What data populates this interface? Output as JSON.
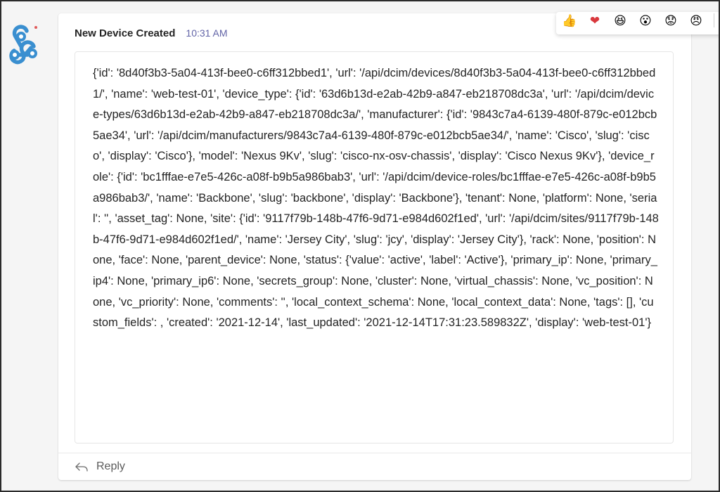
{
  "message": {
    "sender": "New Device Created",
    "time": "10:31 AM",
    "body": "{'id': '8d40f3b3-5a04-413f-bee0-c6ff312bbed1', 'url': '/api/dcim/devices/8d40f3b3-5a04-413f-bee0-c6ff312bbed1/', 'name': 'web-test-01', 'device_type': {'id': '63d6b13d-e2ab-42b9-a847-eb218708dc3a', 'url': '/api/dcim/device-types/63d6b13d-e2ab-42b9-a847-eb218708dc3a/', 'manufacturer': {'id': '9843c7a4-6139-480f-879c-e012bcb5ae34', 'url': '/api/dcim/manufacturers/9843c7a4-6139-480f-879c-e012bcb5ae34/', 'name': 'Cisco', 'slug': 'cisco', 'display': 'Cisco'}, 'model': 'Nexus 9Kv', 'slug': 'cisco-nx-osv-chassis', 'display': 'Cisco Nexus 9Kv'}, 'device_role': {'id': 'bc1fffae-e7e5-426c-a08f-b9b5a986bab3', 'url': '/api/dcim/device-roles/bc1fffae-e7e5-426c-a08f-b9b5a986bab3/', 'name': 'Backbone', 'slug': 'backbone', 'display': 'Backbone'}, 'tenant': None, 'platform': None, 'serial': '', 'asset_tag': None, 'site': {'id': '9117f79b-148b-47f6-9d71-e984d602f1ed', 'url': '/api/dcim/sites/9117f79b-148b-47f6-9d71-e984d602f1ed/', 'name': 'Jersey City', 'slug': 'jcy', 'display': 'Jersey City'}, 'rack': None, 'position': None, 'face': None, 'parent_device': None, 'status': {'value': 'active', 'label': 'Active'}, 'primary_ip': None, 'primary_ip4': None, 'primary_ip6': None, 'secrets_group': None, 'cluster': None, 'virtual_chassis': None, 'vc_position': None, 'vc_priority': None, 'comments': '', 'local_context_schema': None, 'local_context_data': None, 'tags': [], 'custom_fields': , 'created': '2021-12-14', 'last_updated': '2021-12-14T17:31:23.589832Z', 'display': 'web-test-01'}"
  },
  "reply": {
    "label": "Reply",
    "icon": "reply-arrow-icon"
  },
  "avatar": {
    "icon": "webhook-icon",
    "color": "#3a8fd0"
  },
  "reactions": [
    {
      "icon": "like-icon",
      "glyph": "👍"
    },
    {
      "icon": "heart-icon",
      "glyph": "❤"
    },
    {
      "icon": "laugh-icon",
      "glyph": "😆"
    },
    {
      "icon": "surprised-icon",
      "glyph": "😮"
    },
    {
      "icon": "sad-icon",
      "glyph": "😟"
    },
    {
      "icon": "angry-icon",
      "glyph": "😠"
    }
  ],
  "more_label": "···",
  "colors": {
    "accent": "#6264a7",
    "text": "#242424"
  }
}
